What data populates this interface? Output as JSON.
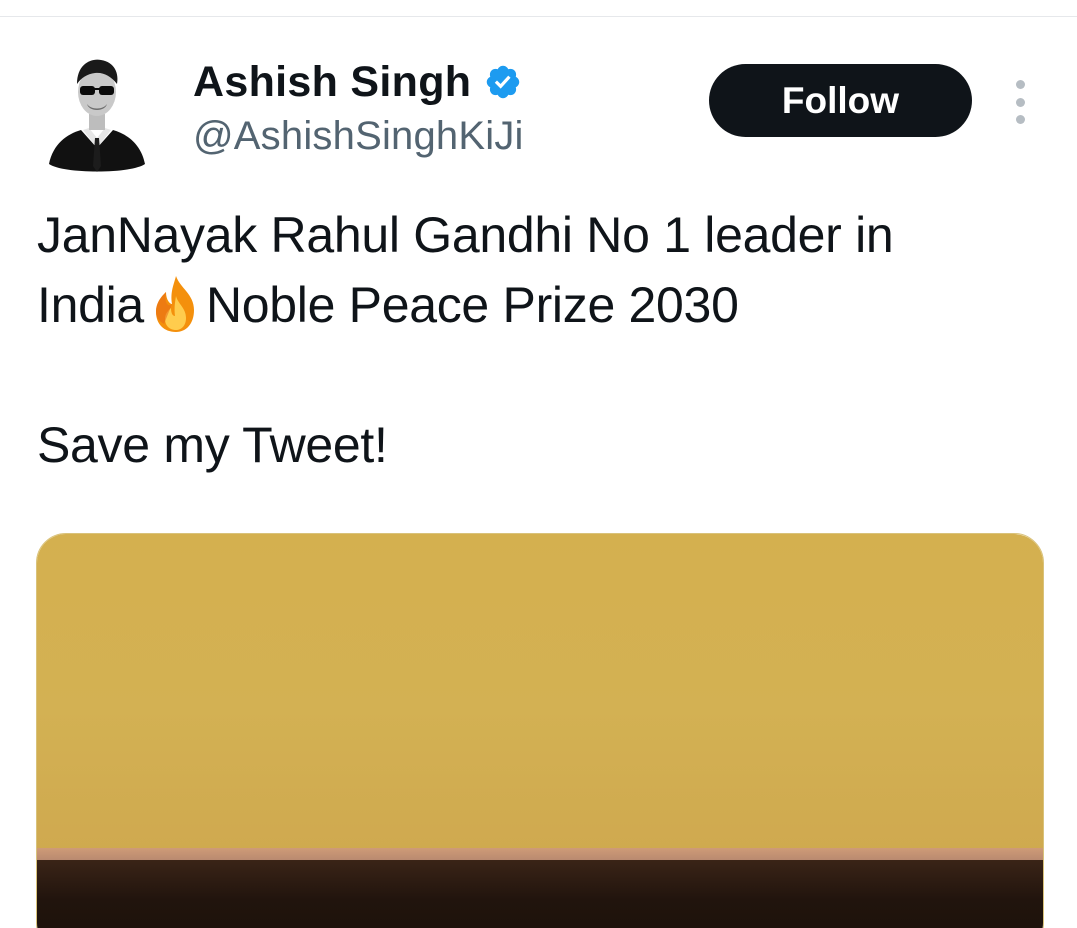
{
  "author": {
    "display_name": "Ashish Singh",
    "handle": "@AshishSinghKiJi",
    "verified": true,
    "verified_icon": "verified-badge-icon",
    "verified_color": "#1d9bf0"
  },
  "actions": {
    "follow_label": "Follow",
    "more_icon": "more-options-icon"
  },
  "tweet": {
    "line1": "JanNayak Rahul Gandhi No 1 leader in",
    "line2_prefix": "India",
    "line2_emoji_icon": "fire-icon",
    "line2_suffix": "Noble Peace Prize 2030",
    "line3": "Save my Tweet!"
  },
  "media": {
    "type": "photo",
    "colors": {
      "wall": "#d4b04f",
      "stripe": "#c8977a",
      "dark": "#21140d"
    }
  },
  "colors": {
    "text_primary": "#0f1419",
    "text_secondary": "#536471",
    "follow_bg": "#0f1419",
    "follow_text": "#ffffff",
    "divider": "#e6e8eb"
  }
}
